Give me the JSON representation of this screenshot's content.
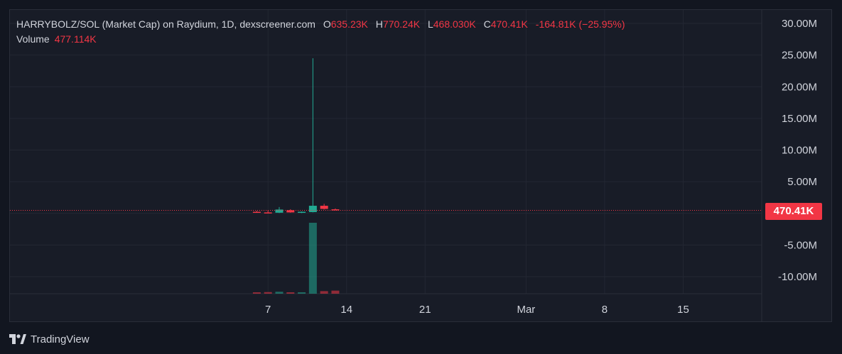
{
  "legend": {
    "title": "HARRYBOLZ/SOL (Market Cap) on Raydium, 1D, dexscreener.com",
    "open_key": "O",
    "open": "635.23K",
    "high_key": "H",
    "high": "770.24K",
    "low_key": "L",
    "low": "468.030K",
    "close_key": "C",
    "close": "470.41K",
    "change": "-164.81K (−25.95%)",
    "volume_label": "Volume",
    "volume": "477.114K"
  },
  "price_badge": "470.41K",
  "brand": "TradingView",
  "colors": {
    "up": "#22ab94",
    "down": "#f23645",
    "background": "#181c27",
    "grid": "#232733"
  },
  "chart_data": {
    "type": "candlestick",
    "series": [
      {
        "name": "HARRYBOLZ/SOL (Market Cap)",
        "candles": [
          {
            "date": "2024-02-06",
            "open": 250000,
            "high": 400000,
            "low": 200000,
            "close": 150000
          },
          {
            "date": "2024-02-07",
            "open": 150000,
            "high": 500000,
            "low": 100000,
            "close": 100000
          },
          {
            "date": "2024-02-08",
            "open": 100000,
            "high": 1000000,
            "low": 50000,
            "close": 600000
          },
          {
            "date": "2024-02-09",
            "open": 500000,
            "high": 650000,
            "low": 100000,
            "close": 150000
          },
          {
            "date": "2024-02-10",
            "open": 150000,
            "high": 300000,
            "low": 50000,
            "close": 250000
          },
          {
            "date": "2024-02-11",
            "open": 200000,
            "high": 24500000,
            "low": 150000,
            "close": 1200000
          },
          {
            "date": "2024-02-12",
            "open": 1200000,
            "high": 1500000,
            "low": 600000,
            "close": 700000
          },
          {
            "date": "2024-02-13",
            "open": 635230,
            "high": 770240,
            "low": 468030,
            "close": 470410
          }
        ]
      },
      {
        "name": "Volume",
        "values": [
          180000,
          250000,
          300000,
          200000,
          150000,
          11000000,
          400000,
          477114
        ],
        "direction": [
          "down",
          "down",
          "up",
          "down",
          "up",
          "up",
          "down",
          "down"
        ]
      }
    ],
    "y_ticks": [
      "30.00M",
      "25.00M",
      "20.00M",
      "15.00M",
      "10.00M",
      "5.00M",
      "0",
      "-5.00M",
      "-10.00M"
    ],
    "y_tick_values": [
      30000000,
      25000000,
      20000000,
      15000000,
      10000000,
      5000000,
      0,
      -5000000,
      -10000000
    ],
    "x_ticks": [
      "7",
      "14",
      "21",
      "Mar",
      "8",
      "15"
    ],
    "x_tick_dates": [
      "2024-02-07",
      "2024-02-14",
      "2024-02-21",
      "2024-03-01",
      "2024-03-08",
      "2024-03-15"
    ],
    "x_range": [
      "2024-01-15",
      "2024-03-22"
    ],
    "ylim": [
      -12000000,
      31000000
    ],
    "last_price": 470410,
    "grid": true,
    "legend_position": "top-left"
  }
}
